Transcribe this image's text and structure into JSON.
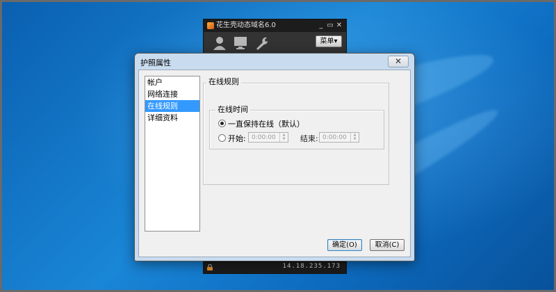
{
  "background_app": {
    "title": "花生壳动态域名6.0",
    "menu_label": "菜单",
    "status_ip": "14.18.235.173",
    "toolbar_icons": [
      "user-icon",
      "monitor-icon",
      "wrench-icon"
    ]
  },
  "dialog": {
    "title": "护照属性",
    "close_glyph": "✕",
    "nav_items": [
      {
        "label": "帐户",
        "selected": false
      },
      {
        "label": "网络连接",
        "selected": false
      },
      {
        "label": "在线规则",
        "selected": true
      },
      {
        "label": "详细资料",
        "selected": false
      }
    ],
    "rules_group_label": "在线规则",
    "time_group_label": "在线时间",
    "option_always": "一直保持在线（默认）",
    "option_start": "开始:",
    "start_time": "0:00:00",
    "end_label": "结束:",
    "end_time": "0:00:00",
    "selected_option": "always",
    "ok_label": "确定(O)",
    "cancel_label": "取消(C)"
  },
  "colors": {
    "desktop": "#1a86d6",
    "selection": "#3399ff",
    "app_accent": "#c85a1a"
  }
}
